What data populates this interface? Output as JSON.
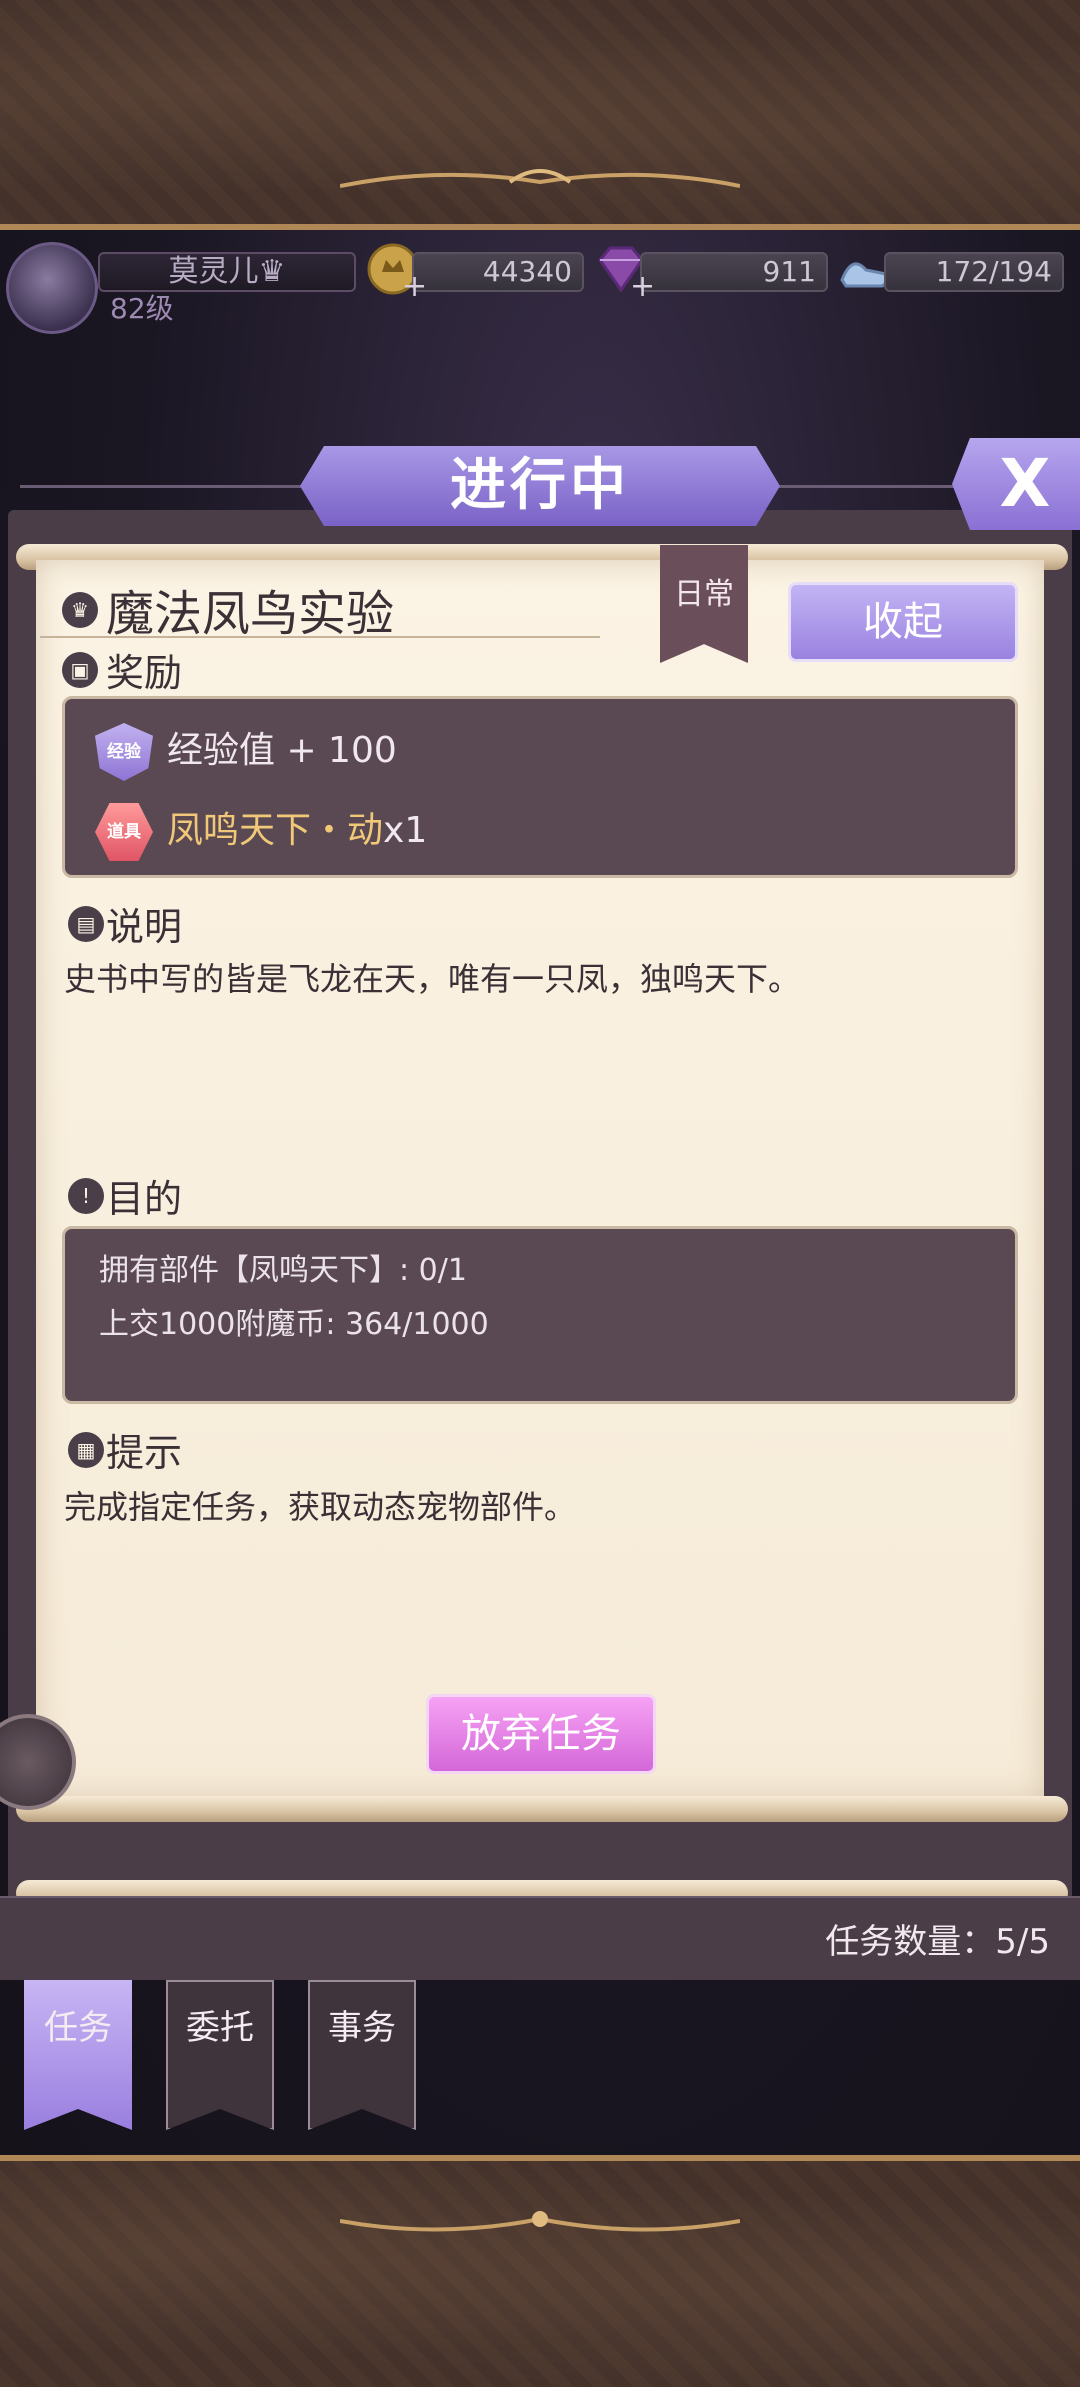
{
  "player": {
    "name": "莫灵儿♛",
    "level": "82级"
  },
  "resources": {
    "gold": "44340",
    "gems": "911",
    "stamina": "172/194"
  },
  "header": {
    "title": "进行中",
    "close_label": "X"
  },
  "quest": {
    "title": "魔法凤鸟实验",
    "tag": "日常",
    "collapse_label": "收起",
    "rewards_heading": "奖励",
    "rewards": [
      {
        "badge": "经验",
        "text": "经验值 + 100"
      },
      {
        "badge": "道具",
        "text_name": "凤鸣天下・动",
        "text_qty": "x1"
      }
    ],
    "description_heading": "说明",
    "description": "史书中写的皆是飞龙在天，唯有一只凤，独鸣天下。",
    "objective_heading": "目的",
    "objectives": [
      "拥有部件【凤鸣天下】: 0/1",
      "上交1000附魔币: 364/1000"
    ],
    "hint_heading": "提示",
    "hint": "完成指定任务，获取动态宠物部件。",
    "abandon_label": "放弃任务"
  },
  "footer": {
    "task_count": "任务数量：5/5"
  },
  "tabs": [
    {
      "label": "任务",
      "active": true
    },
    {
      "label": "委托",
      "active": false
    },
    {
      "label": "事务",
      "active": false
    }
  ],
  "colors": {
    "accent_purple": "#9a82e0",
    "abandon_pink": "#d467d8",
    "paper": "#fbf3e4",
    "dark_box": "#5a4952",
    "item_gold": "#f0c878"
  }
}
